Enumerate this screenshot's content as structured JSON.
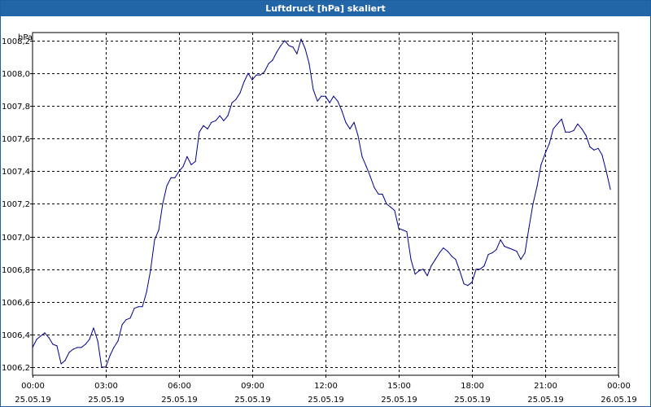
{
  "window": {
    "title": "Luftdruck [hPa] skaliert"
  },
  "chart_data": {
    "type": "line",
    "title": "Luftdruck [hPa] skaliert",
    "ylabel": "hPa",
    "xlabel": "",
    "x_start": "25.05.19 00:00",
    "x_unit": "hours",
    "xlim": [
      0,
      24
    ],
    "ylim": [
      1006.15,
      1008.25
    ],
    "grid": true,
    "line_color": "#00008b",
    "grid_color": "#000000",
    "y_ticks": [
      1006.2,
      1006.4,
      1006.6,
      1006.8,
      1007.0,
      1007.2,
      1007.4,
      1007.6,
      1007.8,
      1008.0,
      1008.2
    ],
    "y_tick_labels": [
      "1006,2",
      "1006,4",
      "1006,6",
      "1006,8",
      "1007,0",
      "1007,2",
      "1007,4",
      "1007,6",
      "1007,8",
      "1008,0",
      "1008,2"
    ],
    "x_ticks": [
      0,
      3,
      6,
      9,
      12,
      15,
      18,
      21,
      24
    ],
    "x_tick_labels": [
      [
        "00:00",
        "25.05.19"
      ],
      [
        "03:00",
        "25.05.19"
      ],
      [
        "06:00",
        "25.05.19"
      ],
      [
        "09:00",
        "25.05.19"
      ],
      [
        "12:00",
        "25.05.19"
      ],
      [
        "15:00",
        "25.05.19"
      ],
      [
        "18:00",
        "25.05.19"
      ],
      [
        "21:00",
        "25.05.19"
      ],
      [
        "00:00",
        "26.05.19"
      ]
    ],
    "series": [
      {
        "points": [
          [
            0.0,
            1006.32
          ],
          [
            0.17,
            1006.37
          ],
          [
            0.33,
            1006.39
          ],
          [
            0.5,
            1006.41
          ],
          [
            0.67,
            1006.38
          ],
          [
            0.83,
            1006.34
          ],
          [
            1.0,
            1006.33
          ],
          [
            1.17,
            1006.22
          ],
          [
            1.33,
            1006.24
          ],
          [
            1.5,
            1006.29
          ],
          [
            1.67,
            1006.31
          ],
          [
            1.83,
            1006.32
          ],
          [
            2.0,
            1006.32
          ],
          [
            2.17,
            1006.34
          ],
          [
            2.33,
            1006.37
          ],
          [
            2.5,
            1006.44
          ],
          [
            2.67,
            1006.36
          ],
          [
            2.83,
            1006.2
          ],
          [
            3.0,
            1006.2
          ],
          [
            3.17,
            1006.27
          ],
          [
            3.33,
            1006.32
          ],
          [
            3.5,
            1006.36
          ],
          [
            3.67,
            1006.46
          ],
          [
            3.83,
            1006.49
          ],
          [
            4.0,
            1006.5
          ],
          [
            4.17,
            1006.56
          ],
          [
            4.33,
            1006.57
          ],
          [
            4.5,
            1006.57
          ],
          [
            4.67,
            1006.66
          ],
          [
            4.83,
            1006.79
          ],
          [
            5.0,
            1006.98
          ],
          [
            5.17,
            1007.04
          ],
          [
            5.33,
            1007.2
          ],
          [
            5.5,
            1007.31
          ],
          [
            5.67,
            1007.36
          ],
          [
            5.83,
            1007.36
          ],
          [
            6.0,
            1007.4
          ],
          [
            6.17,
            1007.43
          ],
          [
            6.33,
            1007.49
          ],
          [
            6.5,
            1007.44
          ],
          [
            6.67,
            1007.46
          ],
          [
            6.83,
            1007.64
          ],
          [
            7.0,
            1007.68
          ],
          [
            7.17,
            1007.66
          ],
          [
            7.33,
            1007.7
          ],
          [
            7.5,
            1007.71
          ],
          [
            7.67,
            1007.74
          ],
          [
            7.83,
            1007.71
          ],
          [
            8.0,
            1007.74
          ],
          [
            8.17,
            1007.82
          ],
          [
            8.33,
            1007.84
          ],
          [
            8.5,
            1007.88
          ],
          [
            8.67,
            1007.95
          ],
          [
            8.83,
            1008.0
          ],
          [
            9.0,
            1007.96
          ],
          [
            9.17,
            1007.99
          ],
          [
            9.33,
            1007.99
          ],
          [
            9.5,
            1008.01
          ],
          [
            9.67,
            1008.06
          ],
          [
            9.83,
            1008.08
          ],
          [
            10.0,
            1008.13
          ],
          [
            10.17,
            1008.17
          ],
          [
            10.33,
            1008.2
          ],
          [
            10.5,
            1008.17
          ],
          [
            10.67,
            1008.16
          ],
          [
            10.83,
            1008.12
          ],
          [
            11.0,
            1008.21
          ],
          [
            11.17,
            1008.15
          ],
          [
            11.33,
            1008.06
          ],
          [
            11.5,
            1007.9
          ],
          [
            11.67,
            1007.83
          ],
          [
            11.83,
            1007.86
          ],
          [
            12.0,
            1007.86
          ],
          [
            12.17,
            1007.82
          ],
          [
            12.33,
            1007.86
          ],
          [
            12.5,
            1007.83
          ],
          [
            12.67,
            1007.77
          ],
          [
            12.83,
            1007.7
          ],
          [
            13.0,
            1007.66
          ],
          [
            13.17,
            1007.7
          ],
          [
            13.33,
            1007.62
          ],
          [
            13.5,
            1007.49
          ],
          [
            13.67,
            1007.43
          ],
          [
            13.83,
            1007.37
          ],
          [
            14.0,
            1007.3
          ],
          [
            14.17,
            1007.26
          ],
          [
            14.33,
            1007.26
          ],
          [
            14.5,
            1007.2
          ],
          [
            14.67,
            1007.18
          ],
          [
            14.83,
            1007.16
          ],
          [
            15.0,
            1007.05
          ],
          [
            15.17,
            1007.04
          ],
          [
            15.33,
            1007.03
          ],
          [
            15.5,
            1006.86
          ],
          [
            15.67,
            1006.77
          ],
          [
            15.83,
            1006.79
          ],
          [
            16.0,
            1006.8
          ],
          [
            16.17,
            1006.76
          ],
          [
            16.33,
            1006.82
          ],
          [
            16.5,
            1006.86
          ],
          [
            16.67,
            1006.9
          ],
          [
            16.83,
            1006.93
          ],
          [
            17.0,
            1006.91
          ],
          [
            17.17,
            1006.88
          ],
          [
            17.33,
            1006.86
          ],
          [
            17.5,
            1006.79
          ],
          [
            17.67,
            1006.71
          ],
          [
            17.83,
            1006.7
          ],
          [
            18.0,
            1006.72
          ],
          [
            18.17,
            1006.8
          ],
          [
            18.33,
            1006.8
          ],
          [
            18.5,
            1006.82
          ],
          [
            18.67,
            1006.89
          ],
          [
            18.83,
            1006.9
          ],
          [
            19.0,
            1006.92
          ],
          [
            19.17,
            1006.98
          ],
          [
            19.33,
            1006.94
          ],
          [
            19.5,
            1006.93
          ],
          [
            19.67,
            1006.92
          ],
          [
            19.83,
            1006.91
          ],
          [
            20.0,
            1006.86
          ],
          [
            20.17,
            1006.9
          ],
          [
            20.33,
            1007.05
          ],
          [
            20.5,
            1007.2
          ],
          [
            20.67,
            1007.31
          ],
          [
            20.83,
            1007.44
          ],
          [
            21.0,
            1007.51
          ],
          [
            21.17,
            1007.57
          ],
          [
            21.33,
            1007.66
          ],
          [
            21.5,
            1007.69
          ],
          [
            21.67,
            1007.72
          ],
          [
            21.83,
            1007.64
          ],
          [
            22.0,
            1007.64
          ],
          [
            22.17,
            1007.65
          ],
          [
            22.33,
            1007.69
          ],
          [
            22.5,
            1007.66
          ],
          [
            22.67,
            1007.62
          ],
          [
            22.83,
            1007.55
          ],
          [
            23.0,
            1007.53
          ],
          [
            23.17,
            1007.54
          ],
          [
            23.33,
            1007.5
          ],
          [
            23.5,
            1007.4
          ],
          [
            23.67,
            1007.29
          ]
        ]
      }
    ]
  }
}
